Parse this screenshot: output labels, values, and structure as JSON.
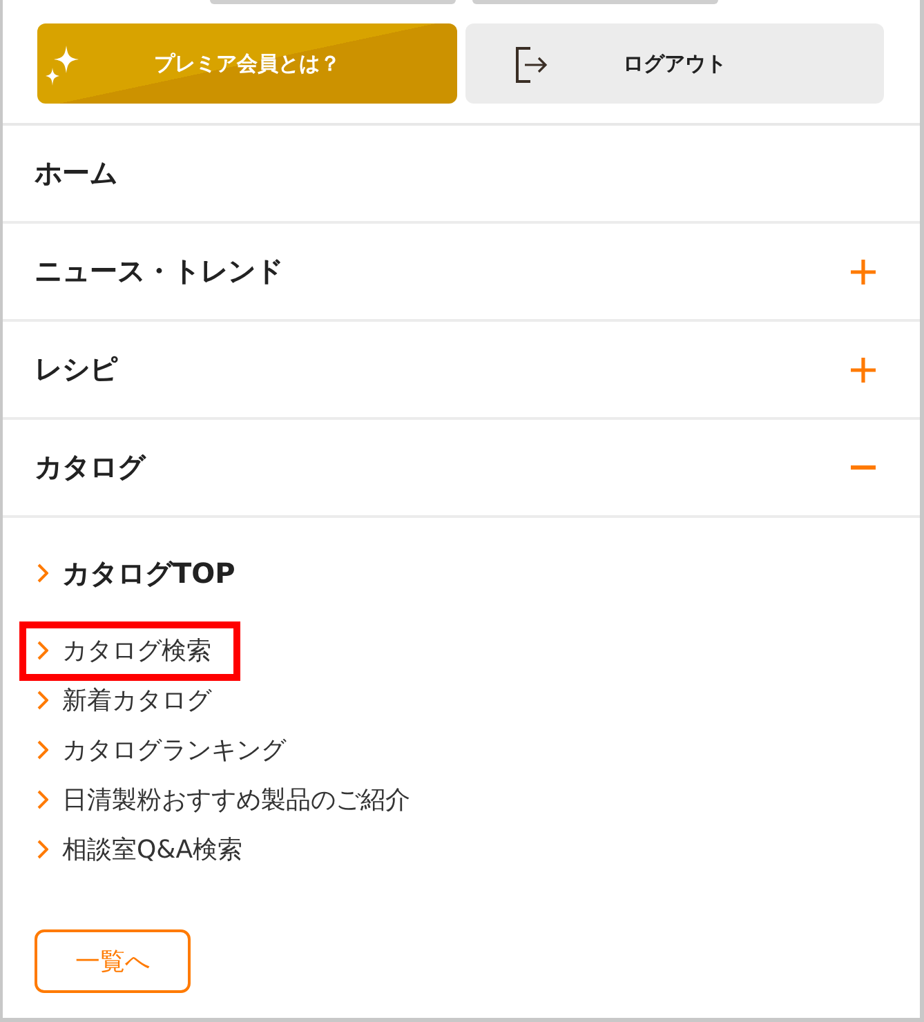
{
  "top_buttons": [
    {
      "kind": "premium",
      "label": "プレミア会員とは？"
    },
    {
      "kind": "logout",
      "label": "ログアウト"
    }
  ],
  "menu": [
    {
      "kind": "link",
      "label": "ホーム"
    },
    {
      "kind": "toggle",
      "label": "ニュース・トレンド",
      "expanded": false
    },
    {
      "kind": "toggle",
      "label": "レシピ",
      "expanded": false
    },
    {
      "kind": "toggle",
      "label": "カタログ",
      "expanded": true,
      "submenu": {
        "top_link": "カタログTOP",
        "links": [
          {
            "label": "カタログ検索",
            "highlighted": true
          },
          {
            "label": "新着カタログ",
            "highlighted": false
          },
          {
            "label": "カタログランキング",
            "highlighted": false
          },
          {
            "label": "日清製粉おすすめ製品のご紹介",
            "highlighted": false
          },
          {
            "label": "相談室Q&A検索",
            "highlighted": false
          }
        ],
        "more_button": "一覧へ"
      }
    }
  ]
}
